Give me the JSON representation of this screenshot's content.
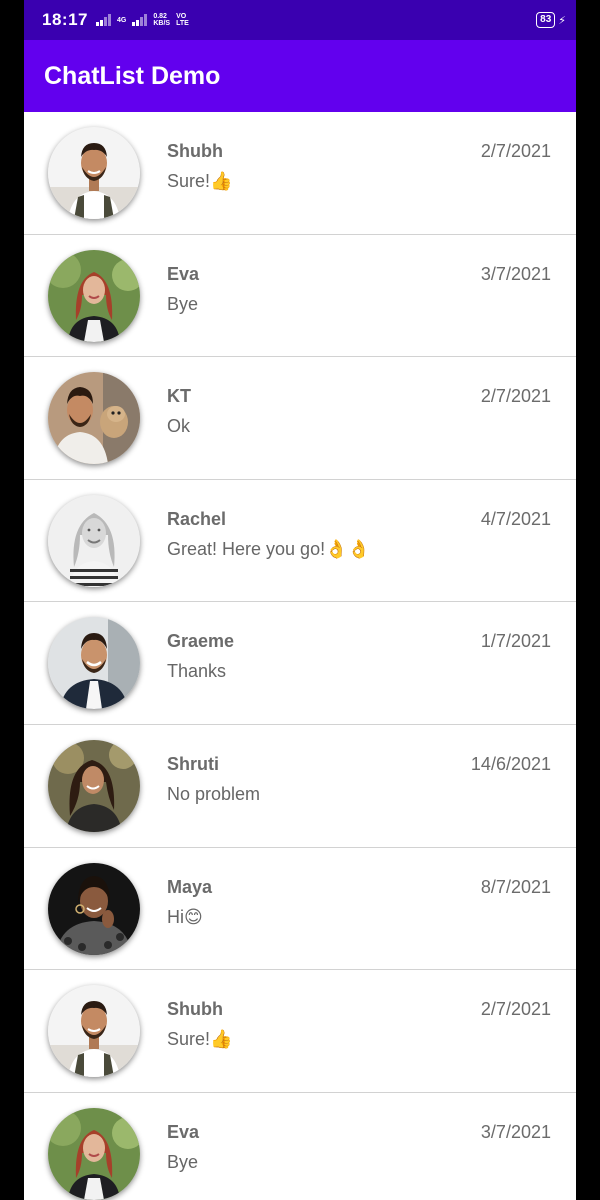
{
  "status_bar": {
    "time": "18:17",
    "net1": "4G",
    "speed_value": "0.82",
    "speed_unit": "KB/S",
    "volte_top": "VO",
    "volte_bottom": "LTE",
    "battery": "83"
  },
  "app_bar": {
    "title": "ChatList Demo"
  },
  "colors": {
    "status_bar": "#3a00b0",
    "app_bar": "#6200ee"
  },
  "chats": [
    {
      "name": "Shubh",
      "message": "Sure!👍",
      "date": "2/7/2021",
      "avatar_icon": "avatar-shubh"
    },
    {
      "name": "Eva",
      "message": "Bye",
      "date": "3/7/2021",
      "avatar_icon": "avatar-eva"
    },
    {
      "name": "KT",
      "message": "Ok",
      "date": "2/7/2021",
      "avatar_icon": "avatar-kt"
    },
    {
      "name": "Rachel",
      "message": "Great! Here you go!👌👌",
      "date": "4/7/2021",
      "avatar_icon": "avatar-rachel"
    },
    {
      "name": "Graeme",
      "message": "Thanks",
      "date": "1/7/2021",
      "avatar_icon": "avatar-graeme"
    },
    {
      "name": "Shruti",
      "message": "No problem",
      "date": "14/6/2021",
      "avatar_icon": "avatar-shruti"
    },
    {
      "name": "Maya",
      "message": "Hi😊",
      "date": "8/7/2021",
      "avatar_icon": "avatar-maya"
    },
    {
      "name": "Shubh",
      "message": "Sure!👍",
      "date": "2/7/2021",
      "avatar_icon": "avatar-shubh"
    },
    {
      "name": "Eva",
      "message": "Bye",
      "date": "3/7/2021",
      "avatar_icon": "avatar-eva"
    }
  ]
}
